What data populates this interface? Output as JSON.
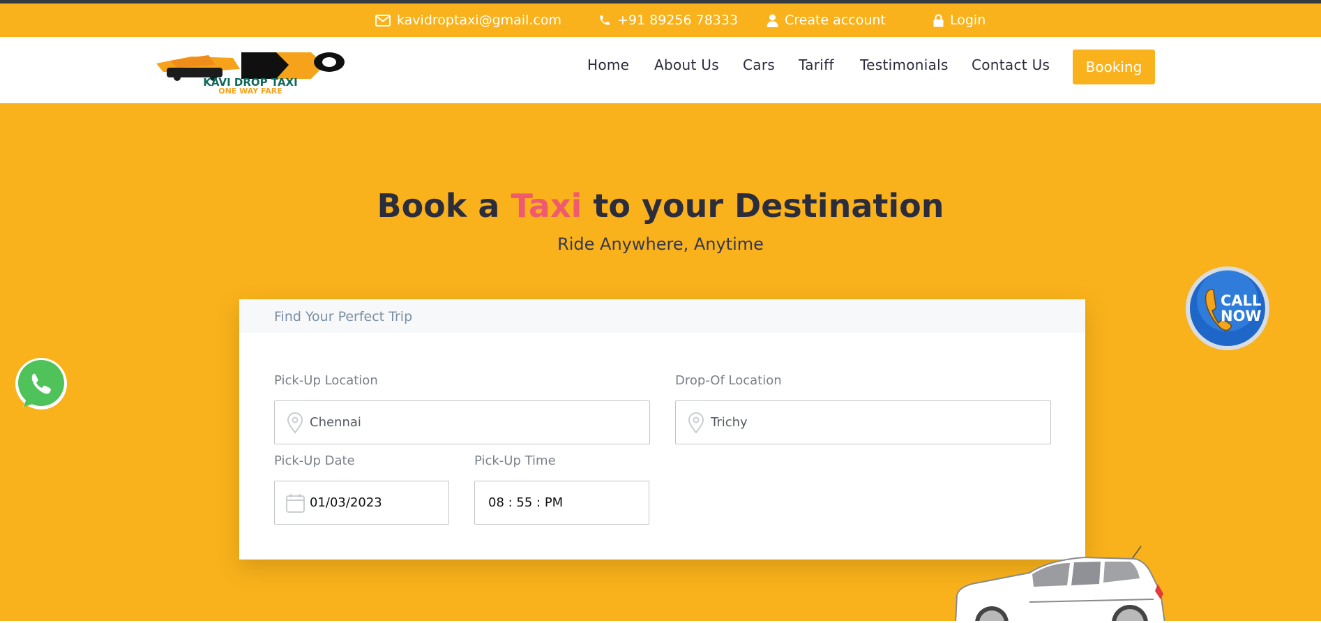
{
  "topbar": {
    "email": "kavidroptaxi@gmail.com",
    "phone": "+91 89256 78333",
    "create_account": "Create account",
    "login": "Login"
  },
  "brand": {
    "logo_line1": "KAVI DROP TAXI",
    "logo_line2": "ONE WAY FARE"
  },
  "nav": {
    "items": [
      "Home",
      "About Us",
      "Cars",
      "Tariff",
      "Testimonials",
      "Contact Us"
    ],
    "booking": "Booking"
  },
  "hero": {
    "title_pre": "Book a",
    "title_accent": "Taxi",
    "title_post": "to your Destination",
    "subtitle": "Ride Anywhere, Anytime"
  },
  "form": {
    "heading": "Find Your Perfect Trip",
    "pickup_label": "Pick-Up Location",
    "pickup_value": "Chennai",
    "drop_label": "Drop-Of Location",
    "drop_value": "Trichy",
    "date_label": "Pick-Up Date",
    "date_value": "01/03/2023",
    "time_label": "Pick-Up Time",
    "time_value": "08 : 55 : PM"
  },
  "floating": {
    "call_line1": "CALL",
    "call_line2": "NOW"
  },
  "colors": {
    "brand_yellow": "#f9b21b",
    "accent_pink": "#f05a6e",
    "heading_dark": "#2b2d3d"
  },
  "icons": [
    "envelope-icon",
    "phone-icon",
    "user-icon",
    "lock-icon",
    "location-pin-icon",
    "calendar-icon",
    "whatsapp-icon",
    "call-now-icon"
  ]
}
